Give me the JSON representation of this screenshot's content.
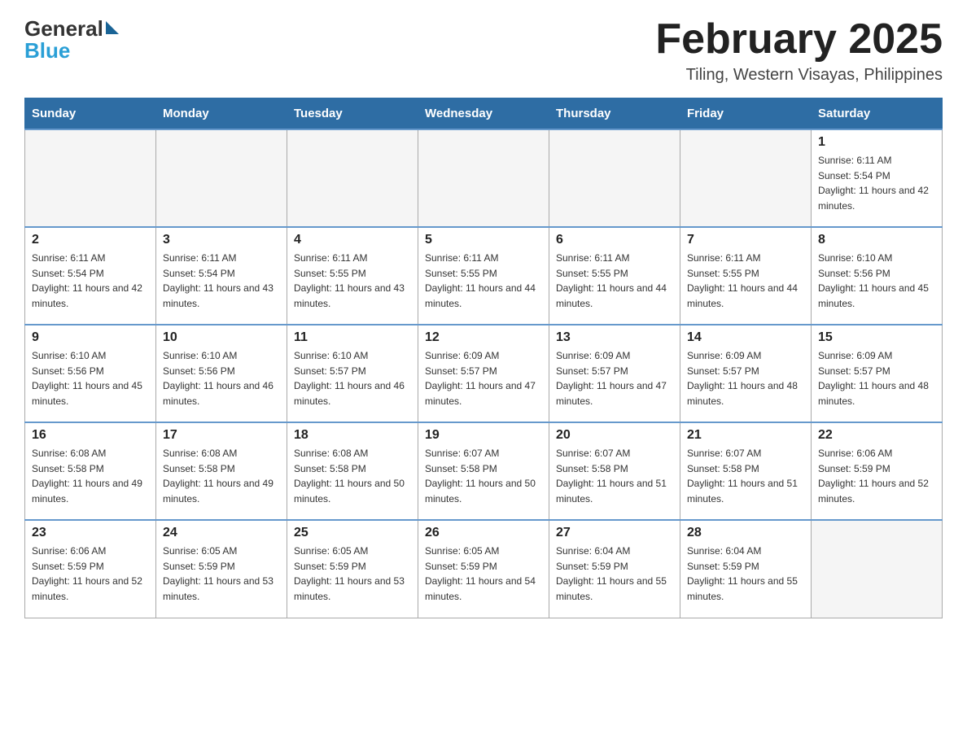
{
  "logo": {
    "general": "General",
    "triangle_symbol": "▶",
    "blue": "Blue"
  },
  "header": {
    "month_year": "February 2025",
    "location": "Tiling, Western Visayas, Philippines"
  },
  "days_of_week": [
    "Sunday",
    "Monday",
    "Tuesday",
    "Wednesday",
    "Thursday",
    "Friday",
    "Saturday"
  ],
  "weeks": [
    {
      "days": [
        {
          "num": "",
          "sunrise": "",
          "sunset": "",
          "daylight": ""
        },
        {
          "num": "",
          "sunrise": "",
          "sunset": "",
          "daylight": ""
        },
        {
          "num": "",
          "sunrise": "",
          "sunset": "",
          "daylight": ""
        },
        {
          "num": "",
          "sunrise": "",
          "sunset": "",
          "daylight": ""
        },
        {
          "num": "",
          "sunrise": "",
          "sunset": "",
          "daylight": ""
        },
        {
          "num": "",
          "sunrise": "",
          "sunset": "",
          "daylight": ""
        },
        {
          "num": "1",
          "sunrise": "Sunrise: 6:11 AM",
          "sunset": "Sunset: 5:54 PM",
          "daylight": "Daylight: 11 hours and 42 minutes."
        }
      ]
    },
    {
      "days": [
        {
          "num": "2",
          "sunrise": "Sunrise: 6:11 AM",
          "sunset": "Sunset: 5:54 PM",
          "daylight": "Daylight: 11 hours and 42 minutes."
        },
        {
          "num": "3",
          "sunrise": "Sunrise: 6:11 AM",
          "sunset": "Sunset: 5:54 PM",
          "daylight": "Daylight: 11 hours and 43 minutes."
        },
        {
          "num": "4",
          "sunrise": "Sunrise: 6:11 AM",
          "sunset": "Sunset: 5:55 PM",
          "daylight": "Daylight: 11 hours and 43 minutes."
        },
        {
          "num": "5",
          "sunrise": "Sunrise: 6:11 AM",
          "sunset": "Sunset: 5:55 PM",
          "daylight": "Daylight: 11 hours and 44 minutes."
        },
        {
          "num": "6",
          "sunrise": "Sunrise: 6:11 AM",
          "sunset": "Sunset: 5:55 PM",
          "daylight": "Daylight: 11 hours and 44 minutes."
        },
        {
          "num": "7",
          "sunrise": "Sunrise: 6:11 AM",
          "sunset": "Sunset: 5:55 PM",
          "daylight": "Daylight: 11 hours and 44 minutes."
        },
        {
          "num": "8",
          "sunrise": "Sunrise: 6:10 AM",
          "sunset": "Sunset: 5:56 PM",
          "daylight": "Daylight: 11 hours and 45 minutes."
        }
      ]
    },
    {
      "days": [
        {
          "num": "9",
          "sunrise": "Sunrise: 6:10 AM",
          "sunset": "Sunset: 5:56 PM",
          "daylight": "Daylight: 11 hours and 45 minutes."
        },
        {
          "num": "10",
          "sunrise": "Sunrise: 6:10 AM",
          "sunset": "Sunset: 5:56 PM",
          "daylight": "Daylight: 11 hours and 46 minutes."
        },
        {
          "num": "11",
          "sunrise": "Sunrise: 6:10 AM",
          "sunset": "Sunset: 5:57 PM",
          "daylight": "Daylight: 11 hours and 46 minutes."
        },
        {
          "num": "12",
          "sunrise": "Sunrise: 6:09 AM",
          "sunset": "Sunset: 5:57 PM",
          "daylight": "Daylight: 11 hours and 47 minutes."
        },
        {
          "num": "13",
          "sunrise": "Sunrise: 6:09 AM",
          "sunset": "Sunset: 5:57 PM",
          "daylight": "Daylight: 11 hours and 47 minutes."
        },
        {
          "num": "14",
          "sunrise": "Sunrise: 6:09 AM",
          "sunset": "Sunset: 5:57 PM",
          "daylight": "Daylight: 11 hours and 48 minutes."
        },
        {
          "num": "15",
          "sunrise": "Sunrise: 6:09 AM",
          "sunset": "Sunset: 5:57 PM",
          "daylight": "Daylight: 11 hours and 48 minutes."
        }
      ]
    },
    {
      "days": [
        {
          "num": "16",
          "sunrise": "Sunrise: 6:08 AM",
          "sunset": "Sunset: 5:58 PM",
          "daylight": "Daylight: 11 hours and 49 minutes."
        },
        {
          "num": "17",
          "sunrise": "Sunrise: 6:08 AM",
          "sunset": "Sunset: 5:58 PM",
          "daylight": "Daylight: 11 hours and 49 minutes."
        },
        {
          "num": "18",
          "sunrise": "Sunrise: 6:08 AM",
          "sunset": "Sunset: 5:58 PM",
          "daylight": "Daylight: 11 hours and 50 minutes."
        },
        {
          "num": "19",
          "sunrise": "Sunrise: 6:07 AM",
          "sunset": "Sunset: 5:58 PM",
          "daylight": "Daylight: 11 hours and 50 minutes."
        },
        {
          "num": "20",
          "sunrise": "Sunrise: 6:07 AM",
          "sunset": "Sunset: 5:58 PM",
          "daylight": "Daylight: 11 hours and 51 minutes."
        },
        {
          "num": "21",
          "sunrise": "Sunrise: 6:07 AM",
          "sunset": "Sunset: 5:58 PM",
          "daylight": "Daylight: 11 hours and 51 minutes."
        },
        {
          "num": "22",
          "sunrise": "Sunrise: 6:06 AM",
          "sunset": "Sunset: 5:59 PM",
          "daylight": "Daylight: 11 hours and 52 minutes."
        }
      ]
    },
    {
      "days": [
        {
          "num": "23",
          "sunrise": "Sunrise: 6:06 AM",
          "sunset": "Sunset: 5:59 PM",
          "daylight": "Daylight: 11 hours and 52 minutes."
        },
        {
          "num": "24",
          "sunrise": "Sunrise: 6:05 AM",
          "sunset": "Sunset: 5:59 PM",
          "daylight": "Daylight: 11 hours and 53 minutes."
        },
        {
          "num": "25",
          "sunrise": "Sunrise: 6:05 AM",
          "sunset": "Sunset: 5:59 PM",
          "daylight": "Daylight: 11 hours and 53 minutes."
        },
        {
          "num": "26",
          "sunrise": "Sunrise: 6:05 AM",
          "sunset": "Sunset: 5:59 PM",
          "daylight": "Daylight: 11 hours and 54 minutes."
        },
        {
          "num": "27",
          "sunrise": "Sunrise: 6:04 AM",
          "sunset": "Sunset: 5:59 PM",
          "daylight": "Daylight: 11 hours and 55 minutes."
        },
        {
          "num": "28",
          "sunrise": "Sunrise: 6:04 AM",
          "sunset": "Sunset: 5:59 PM",
          "daylight": "Daylight: 11 hours and 55 minutes."
        },
        {
          "num": "",
          "sunrise": "",
          "sunset": "",
          "daylight": ""
        }
      ]
    }
  ]
}
